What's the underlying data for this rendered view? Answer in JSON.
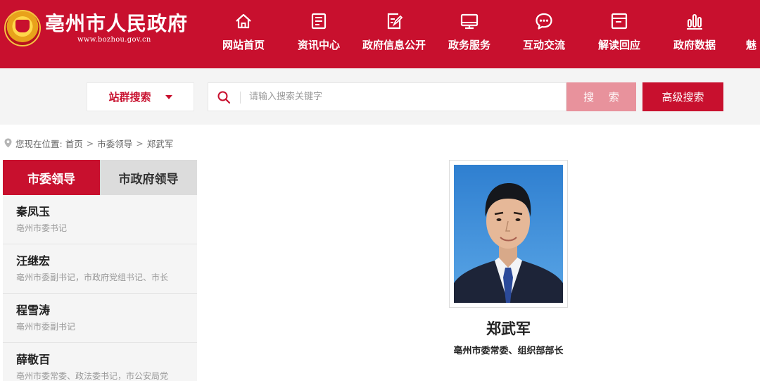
{
  "header": {
    "site_title": "亳州市人民政府",
    "site_url": "www.bozhou.gov.cn",
    "brand_color": "#c8102e",
    "nav": [
      {
        "label": "网站首页",
        "icon": "home-icon"
      },
      {
        "label": "资讯中心",
        "icon": "news-icon"
      },
      {
        "label": "政府信息公开",
        "icon": "edit-document-icon"
      },
      {
        "label": "政务服务",
        "icon": "monitor-icon"
      },
      {
        "label": "互动交流",
        "icon": "chat-icon"
      },
      {
        "label": "解读回应",
        "icon": "folder-icon"
      },
      {
        "label": "政府数据",
        "icon": "bar-chart-icon"
      },
      {
        "label": "魅",
        "icon": "partial-icon"
      }
    ]
  },
  "search": {
    "site_group_label": "站群搜索",
    "placeholder": "请输入搜索关键字",
    "search_label": "搜 索",
    "advanced_label": "高级搜索"
  },
  "breadcrumb": {
    "prefix": "您现在位置:",
    "items": [
      "首页",
      "市委领导",
      "郑武军"
    ]
  },
  "sidebar": {
    "tabs": [
      {
        "label": "市委领导",
        "active": true
      },
      {
        "label": "市政府领导",
        "active": false
      }
    ],
    "leaders": [
      {
        "name": "秦凤玉",
        "position": "亳州市委书记"
      },
      {
        "name": "汪继宏",
        "position": "亳州市委副书记，市政府党组书记、市长"
      },
      {
        "name": "程雪涛",
        "position": "亳州市委副书记"
      },
      {
        "name": "薛敬百",
        "position": "亳州市委常委、政法委书记，市公安局党"
      }
    ]
  },
  "profile": {
    "name": "郑武军",
    "title": "亳州市委常委、组织部部长"
  }
}
